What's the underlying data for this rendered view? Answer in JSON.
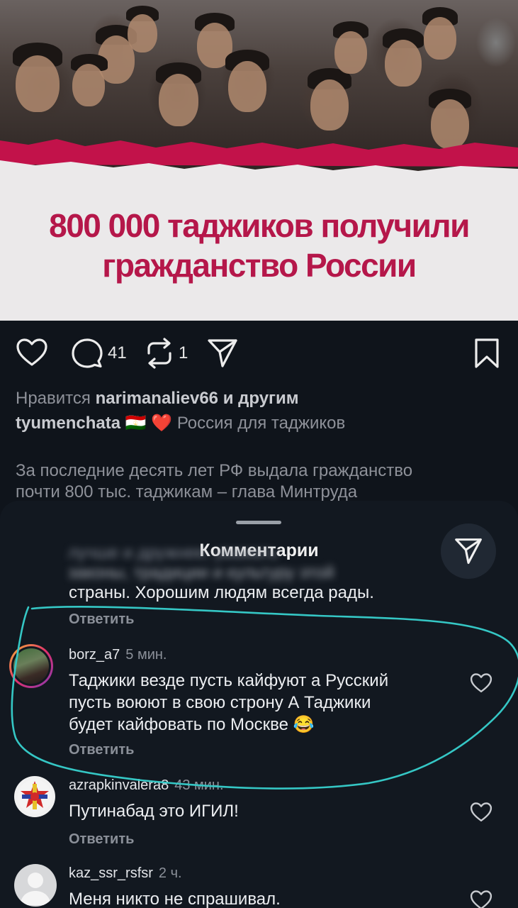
{
  "post": {
    "headline_line1": "800 000 таджиков получили",
    "headline_line2": "гражданство России",
    "comment_count": "41",
    "repost_count": "1",
    "likes_prefix": "Нравится",
    "likes_user": "narimanaliev66",
    "likes_suffix": "и другим",
    "owner": "tyumenchata",
    "owner_emoji": "🇹🇯 ❤️",
    "caption_title": "Россия для таджиков",
    "caption_line1": "За последние десять лет РФ выдала гражданство",
    "caption_line2": "почти 800 тыс. таджикам – глава Минтруда"
  },
  "comments_sheet": {
    "title": "Комментарии",
    "prev_comment_blur1": "лучше и дружнее, уважать",
    "prev_comment_blur2": "законы, традиции и культуру этой",
    "prev_comment_last": "страны. Хорошим людям всегда рады.",
    "prev_reply": "Ответить",
    "comments": [
      {
        "username": "borz_a7",
        "time": "5 мин.",
        "line1": "Таджики везде пусть кайфуют а Русский",
        "line2": "пусть воюют в свою строну А Таджики",
        "line3": "будет кайфовать по Москве 😂",
        "reply": "Ответить"
      },
      {
        "username": "azrapkinvalera8",
        "time": "43 мин.",
        "line1": "Путинабад это ИГИЛ!",
        "reply": "Ответить"
      },
      {
        "username": "kaz_ssr_rsfsr",
        "time": "2 ч.",
        "line1": "Меня никто не спрашивал."
      }
    ]
  },
  "colors": {
    "headline": "#b5174a",
    "torn_edge": "#c2124a",
    "annotation": "#35c7c5",
    "background": "#0f141b"
  },
  "icons": [
    "heart-icon",
    "comment-icon",
    "repost-icon",
    "share-icon",
    "bookmark-icon"
  ]
}
